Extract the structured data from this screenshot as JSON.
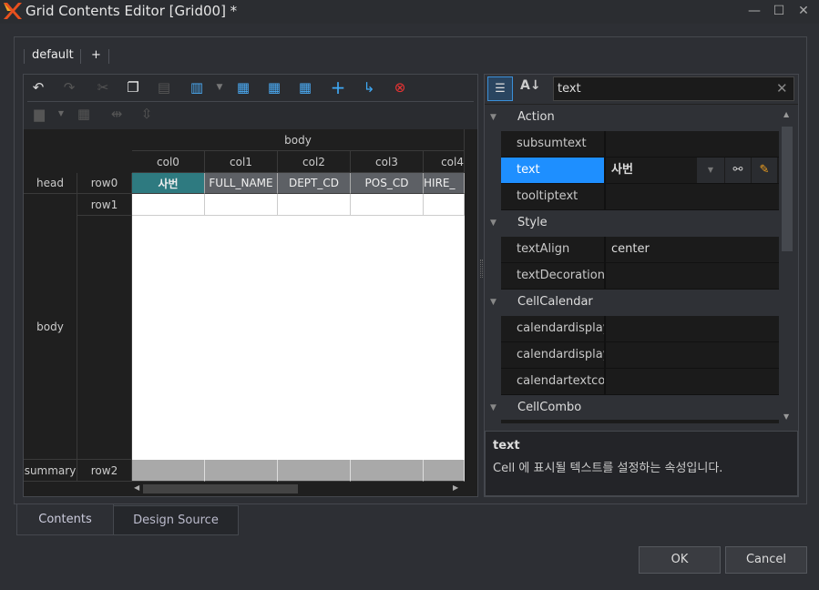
{
  "window": {
    "title": "Grid Contents Editor [Grid00] *",
    "minimize": "—",
    "maximize": "☐",
    "close": "✕"
  },
  "format_tabs": [
    "default",
    "+"
  ],
  "grid": {
    "band_header": "body",
    "columns": [
      "col0",
      "col1",
      "col2",
      "col3",
      "col4"
    ],
    "bands": {
      "head": "head",
      "body": "body",
      "summary": "summary"
    },
    "rows": [
      "row0",
      "row1",
      "row2"
    ],
    "head_cells": [
      "사번",
      "FULL_NAME",
      "DEPT_CD",
      "POS_CD",
      "HIRE_"
    ],
    "selected_color": "#2e7a80"
  },
  "properties": {
    "search_value": "text",
    "groups": [
      {
        "label": "Action",
        "items": [
          {
            "name": "subsumtext",
            "value": ""
          },
          {
            "name": "text",
            "value": "사번"
          },
          {
            "name": "tooltiptext",
            "value": ""
          }
        ]
      },
      {
        "label": "Style",
        "items": [
          {
            "name": "textAlign",
            "value": "center"
          },
          {
            "name": "textDecoration",
            "value": ""
          }
        ]
      },
      {
        "label": "CellCalendar",
        "items": [
          {
            "name": "calendardisplayi",
            "value": ""
          },
          {
            "name": "calendardisplayr",
            "value": ""
          },
          {
            "name": "calendartextcolo",
            "value": ""
          }
        ]
      },
      {
        "label": "CellCombo",
        "items": []
      }
    ],
    "selected_color": "#1e8fff",
    "description": {
      "title": "text",
      "body": "Cell 에 표시될 텍스트를 설정하는 속성입니다."
    }
  },
  "bottom_tabs": [
    "Contents",
    "Design Source"
  ],
  "buttons": {
    "ok": "OK",
    "cancel": "Cancel"
  }
}
